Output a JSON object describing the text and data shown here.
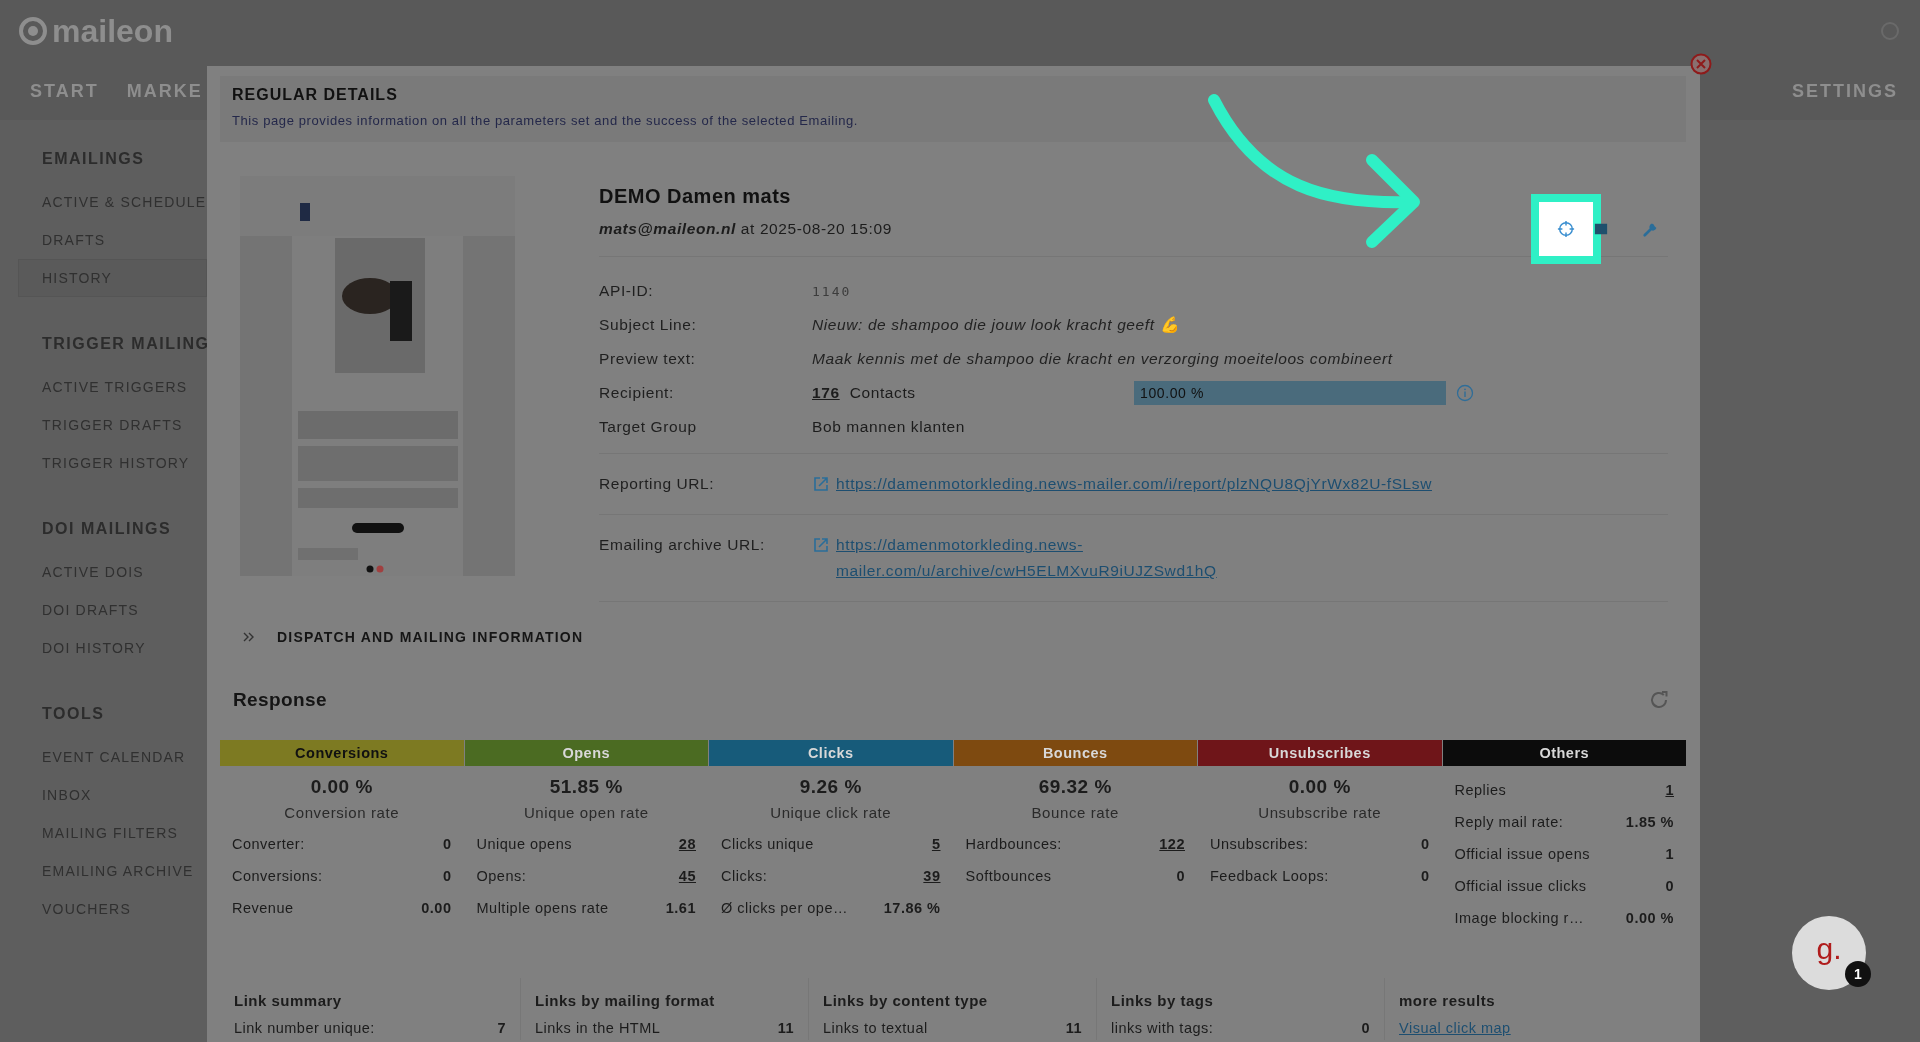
{
  "app": {
    "logo": "maileon",
    "nav": [
      {
        "label": "START"
      },
      {
        "label": "MARKE"
      },
      {
        "label": "SETTINGS"
      }
    ]
  },
  "sidebar": {
    "sections": [
      {
        "title": "EMAILINGS",
        "items": [
          {
            "label": "ACTIVE & SCHEDULE",
            "selected": false
          },
          {
            "label": "DRAFTS",
            "selected": false
          },
          {
            "label": "HISTORY",
            "selected": true
          }
        ]
      },
      {
        "title": "TRIGGER MAILING",
        "items": [
          {
            "label": "ACTIVE TRIGGERS",
            "selected": false
          },
          {
            "label": "TRIGGER DRAFTS",
            "selected": false
          },
          {
            "label": "TRIGGER HISTORY",
            "selected": false
          }
        ]
      },
      {
        "title": "DOI MAILINGS",
        "items": [
          {
            "label": "ACTIVE DOIS",
            "selected": false
          },
          {
            "label": "DOI DRAFTS",
            "selected": false
          },
          {
            "label": "DOI HISTORY",
            "selected": false
          }
        ]
      },
      {
        "title": "TOOLS",
        "items": [
          {
            "label": "EVENT CALENDAR",
            "selected": false
          },
          {
            "label": "INBOX",
            "selected": false
          },
          {
            "label": "MAILING FILTERS",
            "selected": false
          },
          {
            "label": "EMAILING ARCHIVE",
            "selected": false
          },
          {
            "label": "VOUCHERS",
            "selected": false
          }
        ]
      }
    ]
  },
  "dialog": {
    "title": "REGULAR DETAILS",
    "description": "This page provides information on all the parameters set and the success of the selected Emailing.",
    "mailing": {
      "name": "DEMO Damen mats",
      "sender": "mats@maileon.nl",
      "sent": "at 2025-08-20 15:09",
      "fields": [
        {
          "kind": "code",
          "label": "API-ID:",
          "value": "1140"
        },
        {
          "kind": "italic",
          "label": "Subject Line:",
          "value": "Nieuw: de shampoo die jouw look kracht geeft 💪"
        },
        {
          "kind": "italic",
          "label": "Preview text:",
          "value": "Maak kennis met de shampoo die kracht en verzorging moeiteloos combineert"
        },
        {
          "kind": "recipient",
          "label": "Recipient:",
          "count": "176",
          "unit": "Contacts",
          "bar": {
            "text": "100.00 %",
            "level": 1
          }
        },
        {
          "kind": "plain",
          "label": "Target Group",
          "value": "Bob mannen klanten"
        },
        {
          "kind": "url",
          "label": "Reporting URL:",
          "value": "https://damenmotorkleding.news-mailer.com/i/report/plzNQU8QjYrWx82U-fSLsw"
        },
        {
          "kind": "url",
          "label": "Emailing archive URL:",
          "value": "https://damenmotorkleding.news-mailer.com/u/archive/cwH5ELMXvuR9iUJZSwd1hQ"
        }
      ]
    },
    "dispatch_section": {
      "label": "DISPATCH AND MAILING INFORMATION",
      "expanded": false
    },
    "response": {
      "title": "Response",
      "groups": [
        {
          "name": "Conversions",
          "color": "#7d7a22",
          "rate": "0.00 %",
          "rate_label": "Conversion rate",
          "rows": [
            {
              "label": "Converter:",
              "value": "0",
              "link": false
            },
            {
              "label": "Conversions:",
              "value": "0",
              "link": false
            },
            {
              "label": "Revenue",
              "value": "0.00",
              "link": false
            }
          ]
        },
        {
          "name": "Opens",
          "color": "#4b6b22",
          "rate": "51.85 %",
          "rate_label": "Unique open rate",
          "rows": [
            {
              "label": "Unique opens",
              "value": "28",
              "link": true
            },
            {
              "label": "Opens:",
              "value": "45",
              "link": true
            },
            {
              "label": "Multiple opens rate",
              "value": "1.61",
              "link": false
            }
          ]
        },
        {
          "name": "Clicks",
          "color": "#175b7a",
          "rate": "9.26 %",
          "rate_label": "Unique click rate",
          "rows": [
            {
              "label": "Clicks unique",
              "value": "5",
              "link": true
            },
            {
              "label": "Clicks:",
              "value": "39",
              "link": true
            },
            {
              "label": "Ø clicks per ope…",
              "value": "17.86 %",
              "link": false
            }
          ]
        },
        {
          "name": "Bounces",
          "color": "#7e4a10",
          "rate": "69.32 %",
          "rate_label": "Bounce rate",
          "rows": [
            {
              "label": "Hardbounces:",
              "value": "122",
              "link": true
            },
            {
              "label": "Softbounces",
              "value": "0",
              "link": false
            }
          ]
        },
        {
          "name": "Unsubscribes",
          "color": "#6f1519",
          "rate": "0.00 %",
          "rate_label": "Unsubscribe rate",
          "rows": [
            {
              "label": "Unsubscribes:",
              "value": "0",
              "link": false
            },
            {
              "label": "Feedback Loops:",
              "value": "0",
              "link": false
            }
          ]
        },
        {
          "name": "Others",
          "color": "#0c0c0c",
          "rows": [
            {
              "label": "Replies",
              "value": "1",
              "link": true
            },
            {
              "label": "Reply mail rate:",
              "value": "1.85 %",
              "link": false
            },
            {
              "label": "Official issue opens",
              "value": "1",
              "link": false
            },
            {
              "label": "Official issue clicks",
              "value": "0",
              "link": false
            },
            {
              "label": "Image blocking r…",
              "value": "0.00 %",
              "link": false
            }
          ]
        }
      ]
    },
    "link_stats": [
      {
        "title": "Link summary",
        "rows": [
          {
            "label": "Link number unique:",
            "value": "7"
          }
        ]
      },
      {
        "title": "Links by mailing format",
        "rows": [
          {
            "label": "Links in the HTML",
            "value": "11"
          }
        ]
      },
      {
        "title": "Links by content type",
        "rows": [
          {
            "label": "Links to textual",
            "value": "11"
          }
        ]
      },
      {
        "title": "Links by tags",
        "rows": [
          {
            "label": "links with tags:",
            "value": "0"
          }
        ]
      },
      {
        "title": "more results",
        "links": [
          "Visual click map"
        ]
      }
    ]
  },
  "chat": {
    "logo": "g.",
    "badge": "1"
  }
}
